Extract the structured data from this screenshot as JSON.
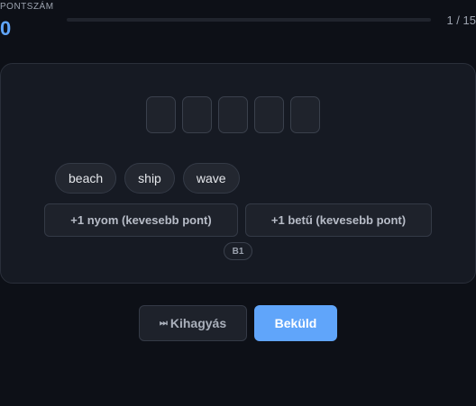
{
  "score": {
    "label": "PONTSZÁM",
    "value": "0"
  },
  "progress": {
    "text": "1 / 15",
    "current": 1,
    "total": 15,
    "fill_fraction": 0
  },
  "puzzle": {
    "slot_count": 5,
    "clue_words": [
      "beach",
      "ship",
      "wave"
    ],
    "hint_buttons": {
      "clue": "+1 nyom (kevesebb pont)",
      "letter": "+1 betű (kevesebb pont)"
    },
    "level": "B1"
  },
  "actions": {
    "skip_icon": "skip-forward-icon",
    "skip_label": "Kihagyás",
    "submit_label": "Beküld"
  },
  "colors": {
    "accent": "#60a5fa",
    "background": "#0d1017",
    "card": "#161a23"
  }
}
